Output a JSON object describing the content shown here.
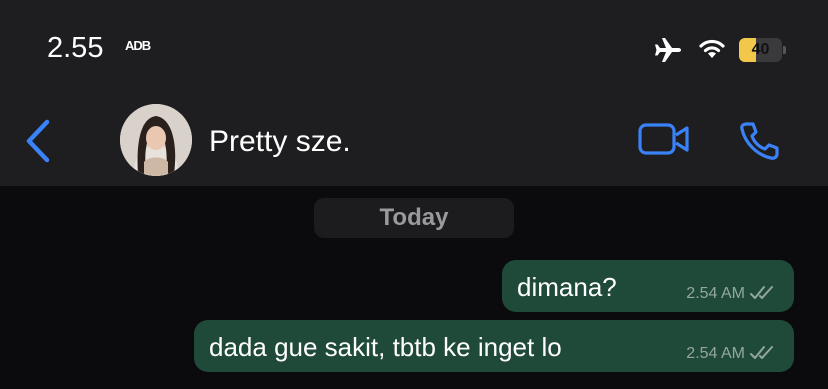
{
  "status_bar": {
    "time": "2.55",
    "time_suffix": "ADB",
    "battery_percent": "40",
    "battery_level": 0.4,
    "icons": [
      "airplane-icon",
      "wifi-icon",
      "battery-icon"
    ]
  },
  "header": {
    "contact_name": "Pretty sze.",
    "icons": [
      "back-chevron-icon",
      "video-call-icon",
      "phone-icon"
    ],
    "accent_color": "#3a82f7",
    "background_color": "#1e1e20"
  },
  "chat": {
    "date_label": "Today",
    "bubble_color": "#1f4a3a",
    "messages": [
      {
        "text": "dimana?",
        "time": "2.54 AM",
        "status_icon": "double-check-icon"
      },
      {
        "text": "dada gue sakit, tbtb ke inget lo",
        "time": "2.54 AM",
        "status_icon": "double-check-icon"
      }
    ]
  }
}
